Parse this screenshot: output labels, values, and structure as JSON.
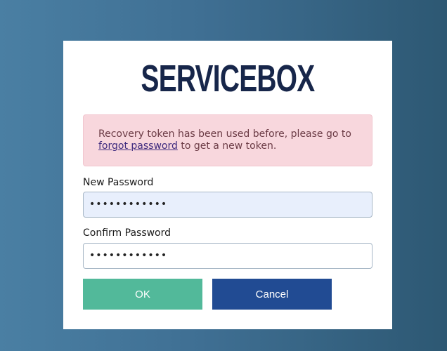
{
  "brand": {
    "name": "SERVICEBOX"
  },
  "alert": {
    "message_before": "Recovery token has been used before, please go to ",
    "link_text": "forgot password",
    "message_after": " to get a new token."
  },
  "form": {
    "new_password": {
      "label": "New Password",
      "value": "••••••••••••"
    },
    "confirm_password": {
      "label": "Confirm Password",
      "value": "••••••••••••"
    }
  },
  "buttons": {
    "ok_label": "OK",
    "cancel_label": "Cancel"
  },
  "colors": {
    "background_start": "#4a7fa3",
    "background_end": "#2d5873",
    "brand": "#17264a",
    "alert_bg": "#f8d7dd",
    "ok": "#52b99a",
    "cancel": "#214b93"
  }
}
